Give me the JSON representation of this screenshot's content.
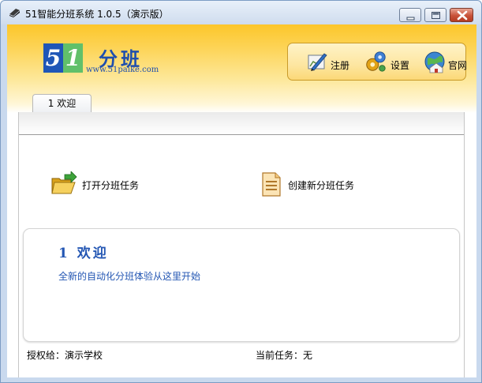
{
  "window": {
    "title": "51智能分班系统 1.0.5（演示版）"
  },
  "logo": {
    "digit_five": "5",
    "digit_one": "1",
    "name": "分班",
    "url": "www.51paike.com"
  },
  "toolbar": {
    "register_label": "注册",
    "settings_label": "设置",
    "website_label": "官网"
  },
  "tabs": [
    {
      "label": "1 欢迎"
    }
  ],
  "actions": {
    "open_task_label": "打开分班任务",
    "create_task_label": "创建新分班任务"
  },
  "welcome": {
    "title": "1 欢迎",
    "subtitle": "全新的自动化分班体验从这里开始"
  },
  "status": {
    "licensed_to": "授权给：演示学校",
    "current_task": "当前任务：无"
  },
  "colors": {
    "banner_top": "#fcc62a",
    "brand_blue": "#1f56b7",
    "brand_green": "#61c06a",
    "link_blue": "#2356b3"
  }
}
